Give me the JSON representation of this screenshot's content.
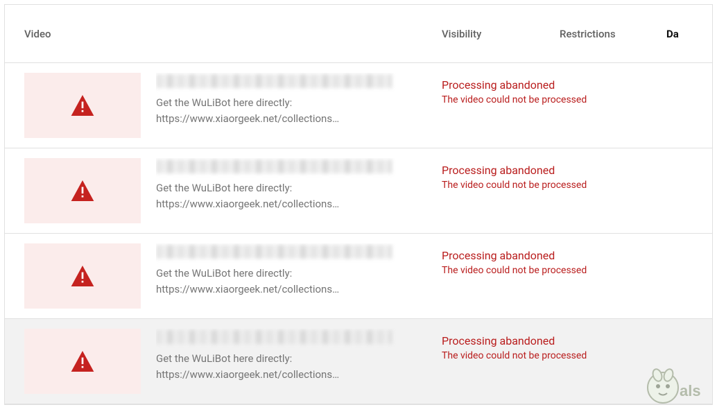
{
  "columns": {
    "video": "Video",
    "visibility": "Visibility",
    "restrictions": "Restrictions",
    "date": "Da"
  },
  "status": {
    "title": "Processing abandoned",
    "subtitle": "The video could not be processed"
  },
  "rows": [
    {
      "description": "Get the WuLiBot here directly: https://www.xiaorgeek.net/collections…"
    },
    {
      "description": "Get the WuLiBot here directly: https://www.xiaorgeek.net/collections…"
    },
    {
      "description": "Get the WuLiBot here directly: https://www.xiaorgeek.net/collections…"
    },
    {
      "description": "Get the WuLiBot here directly: https://www.xiaorgeek.net/collections…"
    }
  ],
  "icons": {
    "thumb": "warning-triangle-icon"
  },
  "colors": {
    "error": "#b91d1d",
    "thumbBg": "#fbeceb"
  }
}
